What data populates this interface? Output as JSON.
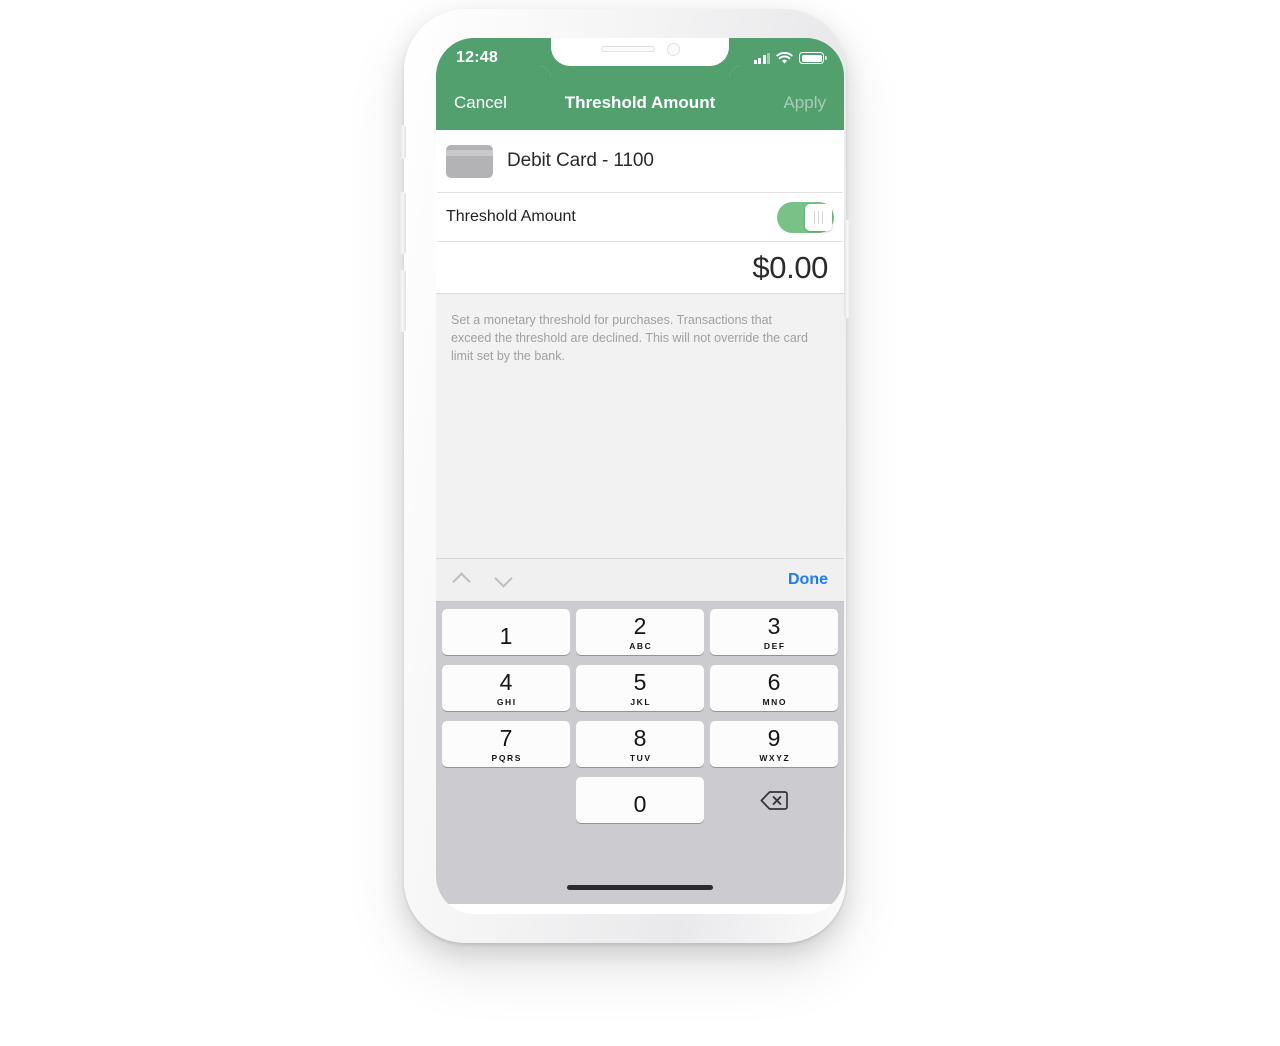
{
  "device": {
    "type": "smartphone-mockup",
    "frame_color": "#f2f2f4",
    "hardware_buttons": [
      "silent-switch",
      "volume-up",
      "volume-down",
      "power"
    ]
  },
  "status_bar": {
    "time": "12:48",
    "signal_icon": "cellular-signal-icon",
    "wifi_icon": "wifi-icon",
    "battery_icon": "battery-full-icon",
    "text_color": "#ffffff"
  },
  "nav_bar": {
    "background_color": "#52a06e",
    "cancel_label": "Cancel",
    "title": "Threshold Amount",
    "apply_label": "Apply",
    "apply_enabled": false
  },
  "card_row": {
    "icon": "credit-card-icon",
    "label": "Debit Card - 1100"
  },
  "toggle_cell": {
    "label": "Threshold Amount",
    "enabled": true,
    "track_color": "#78c187"
  },
  "amount_field": {
    "value": "$0.00",
    "placeholder": "$0.00"
  },
  "description": {
    "text": "Set a monetary threshold for purchases. Transactions that exceed the threshold are declined. This will not override the card limit set by the bank."
  },
  "keyboard": {
    "accessory": {
      "prev_icon": "chevron-up-icon",
      "next_icon": "chevron-down-icon",
      "nav_enabled": false,
      "done_label": "Done",
      "done_color": "#1f7bf5"
    },
    "rows": [
      [
        {
          "num": "1",
          "letters": ""
        },
        {
          "num": "2",
          "letters": "ABC"
        },
        {
          "num": "3",
          "letters": "DEF"
        }
      ],
      [
        {
          "num": "4",
          "letters": "GHI"
        },
        {
          "num": "5",
          "letters": "JKL"
        },
        {
          "num": "6",
          "letters": "MNO"
        }
      ],
      [
        {
          "num": "7",
          "letters": "PQRS"
        },
        {
          "num": "8",
          "letters": "TUV"
        },
        {
          "num": "9",
          "letters": "WXYZ"
        }
      ]
    ],
    "zero_key": {
      "num": "0",
      "letters": ""
    },
    "delete_icon": "backspace-delete-icon",
    "background_color": "#ccccd0"
  },
  "home_indicator": {
    "visible": true
  }
}
